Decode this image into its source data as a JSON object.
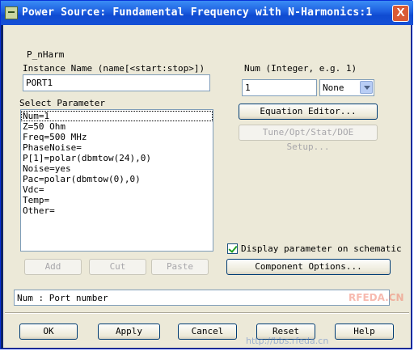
{
  "window": {
    "title": "Power Source: Fundamental Frequency with N-Harmonics:1",
    "close_label": "X"
  },
  "component_name": "P_nHarm",
  "instance": {
    "label": "Instance Name  (name[<start:stop>])",
    "value": "PORT1"
  },
  "num": {
    "label": "Num (Integer, e.g. 1)",
    "value": "1",
    "unit_selected": "None"
  },
  "params": {
    "label": "Select Parameter",
    "items": [
      "Num=1",
      "Z=50 Ohm",
      "Freq=500 MHz",
      "PhaseNoise=",
      "P[1]=polar(dbmtow(24),0)",
      "Noise=yes",
      "Pac=polar(dbmtow(0),0)",
      "Vdc=",
      "Temp=",
      "Other="
    ]
  },
  "buttons": {
    "equation_editor": "Equation Editor...",
    "tune_setup": "Tune/Opt/Stat/DOE Setup...",
    "add": "Add",
    "cut": "Cut",
    "paste": "Paste",
    "component_options": "Component Options...",
    "ok": "OK",
    "apply": "Apply",
    "cancel": "Cancel",
    "reset": "Reset",
    "help": "Help"
  },
  "display_param": {
    "label": "Display parameter on schematic",
    "checked": true
  },
  "status": "Num : Port number",
  "watermark": {
    "site": "RFEDA.CN",
    "url": "http://bbs.rfeda.cn"
  }
}
